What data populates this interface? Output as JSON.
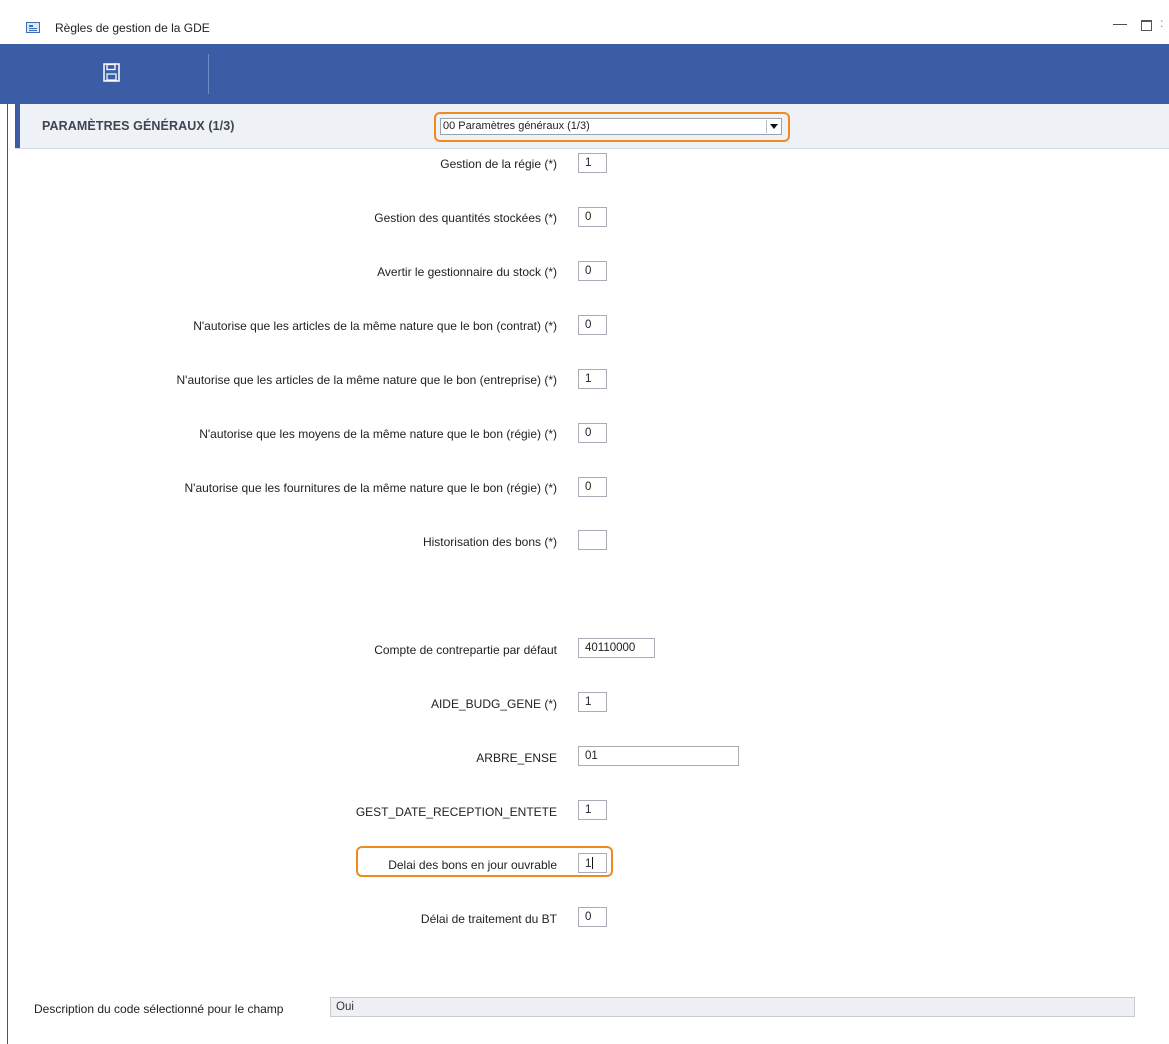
{
  "window": {
    "title": "Règles de gestion de la GDE",
    "icon": "form-icon",
    "controls": {
      "minimize": "—",
      "maximize": "",
      "close": ":"
    }
  },
  "toolbar": {
    "save_icon": "save-icon"
  },
  "section": {
    "title": "PARAMÈTRES GÉNÉRAUX (1/3)",
    "selector_value": "00  Paramètres généraux (1/3)",
    "accent_color": "#3a5da5",
    "highlight_color": "#f08a1d"
  },
  "fields": [
    {
      "label": "Gestion de la régie (*)",
      "value": "1"
    },
    {
      "label": "Gestion des quantités stockées (*)",
      "value": "0"
    },
    {
      "label": "Avertir le gestionnaire du stock (*)",
      "value": "0"
    },
    {
      "label": "N'autorise que les articles de la même nature que le bon (contrat) (*)",
      "value": "0"
    },
    {
      "label": "N'autorise que les articles de la même nature que le bon (entreprise) (*)",
      "value": "1"
    },
    {
      "label": "N'autorise que les moyens de la même nature que le bon (régie) (*)",
      "value": "0"
    },
    {
      "label": "N'autorise que les fournitures de la même nature que le bon (régie) (*)",
      "value": "0"
    },
    {
      "label": "Historisation des bons (*)",
      "value": ""
    },
    {
      "label": "Compte de contrepartie par défaut",
      "value": "40110000"
    },
    {
      "label": "AIDE_BUDG_GENE (*)",
      "value": "1"
    },
    {
      "label": "ARBRE_ENSE",
      "value": "01"
    },
    {
      "label": "GEST_DATE_RECEPTION_ENTETE",
      "value": "1"
    },
    {
      "label": "Delai des bons en jour ouvrable",
      "value": "1"
    },
    {
      "label": "Délai de traitement du BT",
      "value": "0"
    }
  ],
  "description": {
    "label": "Description du code sélectionné pour le champ",
    "value": "Oui"
  }
}
